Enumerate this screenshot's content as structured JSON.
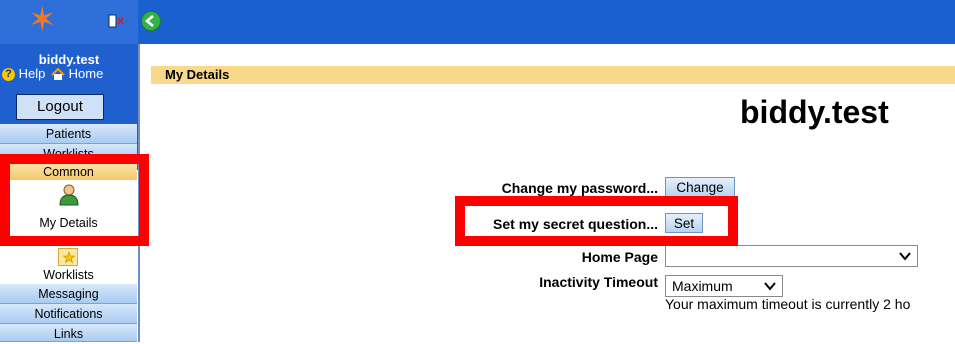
{
  "app": {
    "accent": "#1a5fd0",
    "header_color": "#fad88a",
    "highlight_color": "#ff0000"
  },
  "sidebar": {
    "username": "biddy.test",
    "help_label": "Help",
    "home_label": "Home",
    "logout_label": "Logout",
    "items": [
      {
        "label": "Patients"
      },
      {
        "label": "Worklists"
      },
      {
        "label": "Common"
      },
      {
        "label": "My Details"
      },
      {
        "label": "Worklists"
      },
      {
        "label": "Messaging"
      },
      {
        "label": "Notifications"
      },
      {
        "label": "Links"
      }
    ]
  },
  "main": {
    "section_title": "My Details",
    "user_heading": "biddy.test",
    "change_password_label": "Change my password...",
    "change_button": "Change",
    "secret_question_label": "Set my secret question...",
    "set_button": "Set",
    "home_page_label": "Home Page",
    "home_page_value": "",
    "inactivity_label": "Inactivity Timeout",
    "inactivity_value": "Maximum",
    "timeout_note": "Your maximum timeout is currently 2 ho"
  }
}
